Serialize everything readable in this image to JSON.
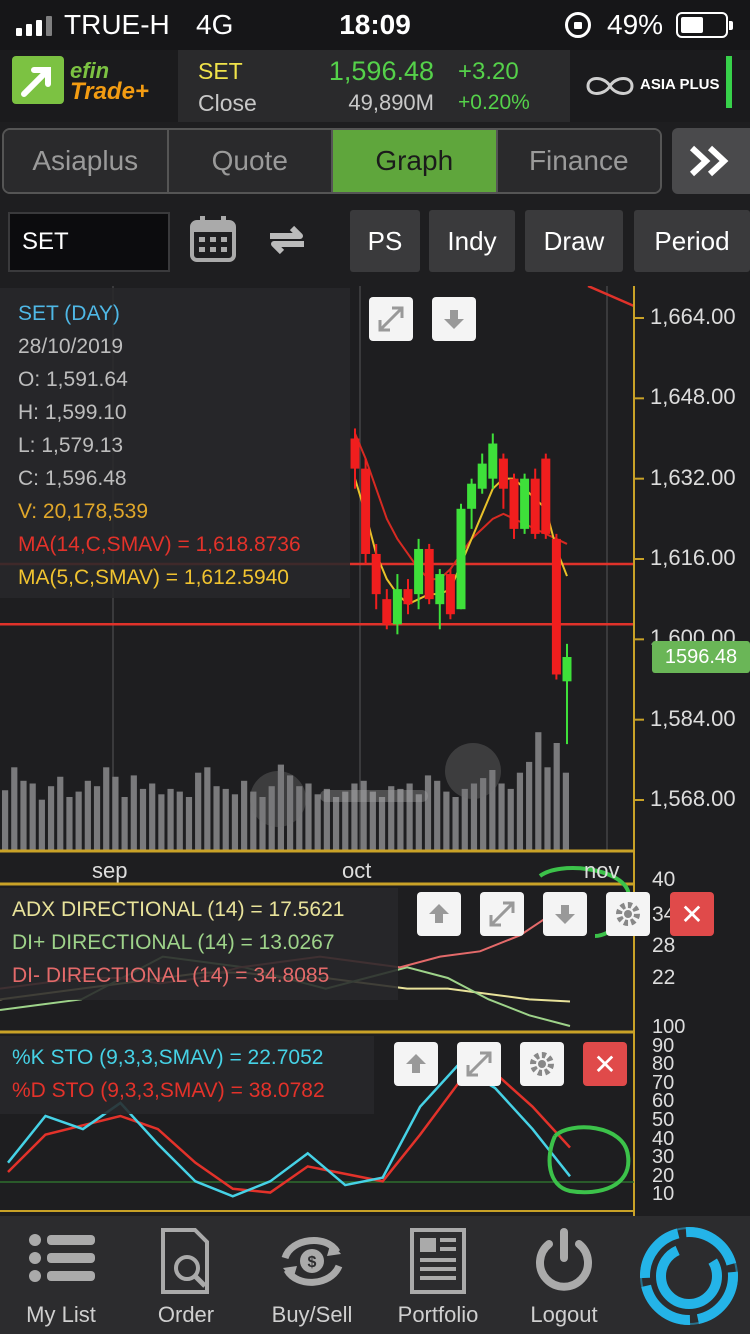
{
  "status_bar": {
    "carrier": "TRUE-H",
    "network": "4G",
    "time": "18:09",
    "battery": "49%",
    "battery_level": 0.49
  },
  "header": {
    "logo_top": "efin",
    "logo_bottom": "Trade+",
    "quote": {
      "symbol": "SET",
      "close_label": "Close",
      "price": "1,596.48",
      "volume": "49,890M",
      "change": "+3.20",
      "change_pct": "+0.20%"
    },
    "brand": "ASIA PLUS",
    "colors": {
      "up": "#55d14a",
      "accent": "#5fa63c",
      "symbol": "#f0e34a"
    }
  },
  "tabs": [
    {
      "label": "Asiaplus",
      "active": false
    },
    {
      "label": "Quote",
      "active": false
    },
    {
      "label": "Graph",
      "active": true
    },
    {
      "label": "Finance",
      "active": false
    }
  ],
  "tabs_more_icon": "double-chevron-right-icon",
  "toolbar": {
    "symbol_value": "SET",
    "calendar_icon": "calendar-icon",
    "refresh_icon": "refresh-icon",
    "buttons": [
      "PS",
      "Indy",
      "Draw",
      "Period"
    ]
  },
  "main_panel": {
    "title": "SET (DAY)",
    "date": "28/10/2019",
    "open": "O: 1,591.64",
    "high": "H: 1,599.10",
    "low": "L: 1,579.13",
    "close": "C: 1,596.48",
    "volume": "V: 20,178,539",
    "ma14": "MA(14,C,SMAV) = 1,618.8736",
    "ma5": "MA(5,C,SMAV) = 1,612.5940",
    "price_labels": [
      "1,664.00",
      "1,648.00",
      "1,632.00",
      "1,616.00",
      "1,600.00",
      "1,584.00",
      "1,568.00"
    ],
    "current_price_tag": "1596.48",
    "month_labels": [
      "sep",
      "oct",
      "nov"
    ]
  },
  "adx_panel": {
    "adx": "ADX DIRECTIONAL (14) = 17.5621",
    "di_plus": "DI+ DIRECTIONAL (14) = 13.0267",
    "di_minus": "DI- DIRECTIONAL (14) = 34.8085",
    "scale": [
      "40",
      "34",
      "28",
      "22"
    ]
  },
  "sto_panel": {
    "k": "%K STO (9,3,3,SMAV) = 22.7052",
    "d": "%D STO (9,3,3,SMAV) = 38.0782",
    "scale": [
      "100",
      "90",
      "80",
      "70",
      "60",
      "50",
      "40",
      "30",
      "20",
      "10"
    ]
  },
  "chart_data": {
    "type": "candlestick",
    "title": "SET (DAY)",
    "ohlc_last": {
      "date": "28/10/2019",
      "open": 1591.64,
      "high": 1599.1,
      "low": 1579.13,
      "close": 1596.48,
      "volume": 20178539
    },
    "candles": [
      {
        "o": 1640,
        "h": 1642,
        "l": 1630,
        "c": 1634
      },
      {
        "o": 1634,
        "h": 1636,
        "l": 1615,
        "c": 1617
      },
      {
        "o": 1617,
        "h": 1619,
        "l": 1606,
        "c": 1609
      },
      {
        "o": 1608,
        "h": 1610,
        "l": 1602,
        "c": 1603
      },
      {
        "o": 1603,
        "h": 1613,
        "l": 1601,
        "c": 1610
      },
      {
        "o": 1610,
        "h": 1612,
        "l": 1605,
        "c": 1607
      },
      {
        "o": 1609,
        "h": 1620,
        "l": 1606,
        "c": 1618
      },
      {
        "o": 1618,
        "h": 1619,
        "l": 1607,
        "c": 1608
      },
      {
        "o": 1607,
        "h": 1614,
        "l": 1602,
        "c": 1613
      },
      {
        "o": 1613,
        "h": 1614,
        "l": 1604,
        "c": 1605
      },
      {
        "o": 1606,
        "h": 1627,
        "l": 1606,
        "c": 1626
      },
      {
        "o": 1626,
        "h": 1632,
        "l": 1622,
        "c": 1631
      },
      {
        "o": 1630,
        "h": 1637,
        "l": 1629,
        "c": 1635
      },
      {
        "o": 1632,
        "h": 1641,
        "l": 1630,
        "c": 1639
      },
      {
        "o": 1636,
        "h": 1637,
        "l": 1626,
        "c": 1630
      },
      {
        "o": 1632,
        "h": 1633,
        "l": 1620,
        "c": 1622
      },
      {
        "o": 1622,
        "h": 1633,
        "l": 1621,
        "c": 1632
      },
      {
        "o": 1632,
        "h": 1634,
        "l": 1620,
        "c": 1621
      },
      {
        "o": 1636,
        "h": 1637,
        "l": 1620,
        "c": 1621
      },
      {
        "o": 1620,
        "h": 1621,
        "l": 1592,
        "c": 1593
      },
      {
        "o": 1591.64,
        "h": 1599.1,
        "l": 1579.13,
        "c": 1596.48
      }
    ],
    "ma14": [
      1641,
      1636,
      1630,
      1624,
      1620,
      1617,
      1614,
      1612,
      1612,
      1614,
      1617,
      1620,
      1622,
      1624,
      1625,
      1624,
      1623,
      1622,
      1621,
      1620,
      1619
    ],
    "ma5": [
      1632,
      1625,
      1617,
      1612,
      1609,
      1607,
      1608,
      1609,
      1609,
      1610,
      1615,
      1620,
      1625,
      1630,
      1632,
      1632,
      1630,
      1628,
      1626,
      1618,
      1612.6
    ],
    "volume_bars": [
      45,
      62,
      52,
      50,
      38,
      48,
      55,
      40,
      44,
      52,
      48,
      62,
      55,
      40,
      56,
      46,
      50,
      42,
      46,
      44,
      40,
      58,
      62,
      48,
      46,
      42,
      52,
      44,
      40,
      48,
      64,
      56,
      48,
      50,
      42,
      46,
      40,
      44,
      50,
      52,
      44,
      40,
      48,
      46,
      50,
      42,
      56,
      52,
      44,
      40,
      46,
      50,
      54,
      60,
      50,
      46,
      58,
      66,
      88,
      62,
      80,
      58
    ],
    "y_range": [
      1562,
      1672
    ],
    "horizontal_lines": [
      1615,
      1603
    ],
    "adx_series": {
      "adx": [
        18,
        19,
        20,
        21,
        22,
        23,
        23,
        22,
        22,
        21,
        20,
        20,
        19,
        18,
        17.6
      ],
      "di_plus": [
        16,
        17,
        18,
        22,
        26,
        25,
        24,
        22,
        20,
        22,
        24,
        22,
        18,
        15,
        13
      ],
      "di_minus": [
        20,
        21,
        22,
        22,
        21,
        22,
        24,
        25,
        26,
        25,
        24,
        26,
        27,
        30,
        35
      ]
    },
    "sto_series": {
      "k": [
        30,
        55,
        48,
        62,
        40,
        20,
        12,
        20,
        35,
        18,
        22,
        60,
        82,
        70,
        48,
        22.7
      ],
      "d": [
        25,
        45,
        50,
        55,
        48,
        30,
        16,
        14,
        28,
        24,
        20,
        45,
        72,
        78,
        60,
        38.1
      ]
    }
  },
  "bottom_nav": [
    {
      "label": "My List",
      "icon": "list-icon"
    },
    {
      "label": "Order",
      "icon": "order-search-icon"
    },
    {
      "label": "Buy/Sell",
      "icon": "buy-sell-icon"
    },
    {
      "label": "Portfolio",
      "icon": "portfolio-icon"
    },
    {
      "label": "Logout",
      "icon": "power-icon"
    },
    {
      "label": "",
      "icon": "app-logo-icon"
    }
  ]
}
